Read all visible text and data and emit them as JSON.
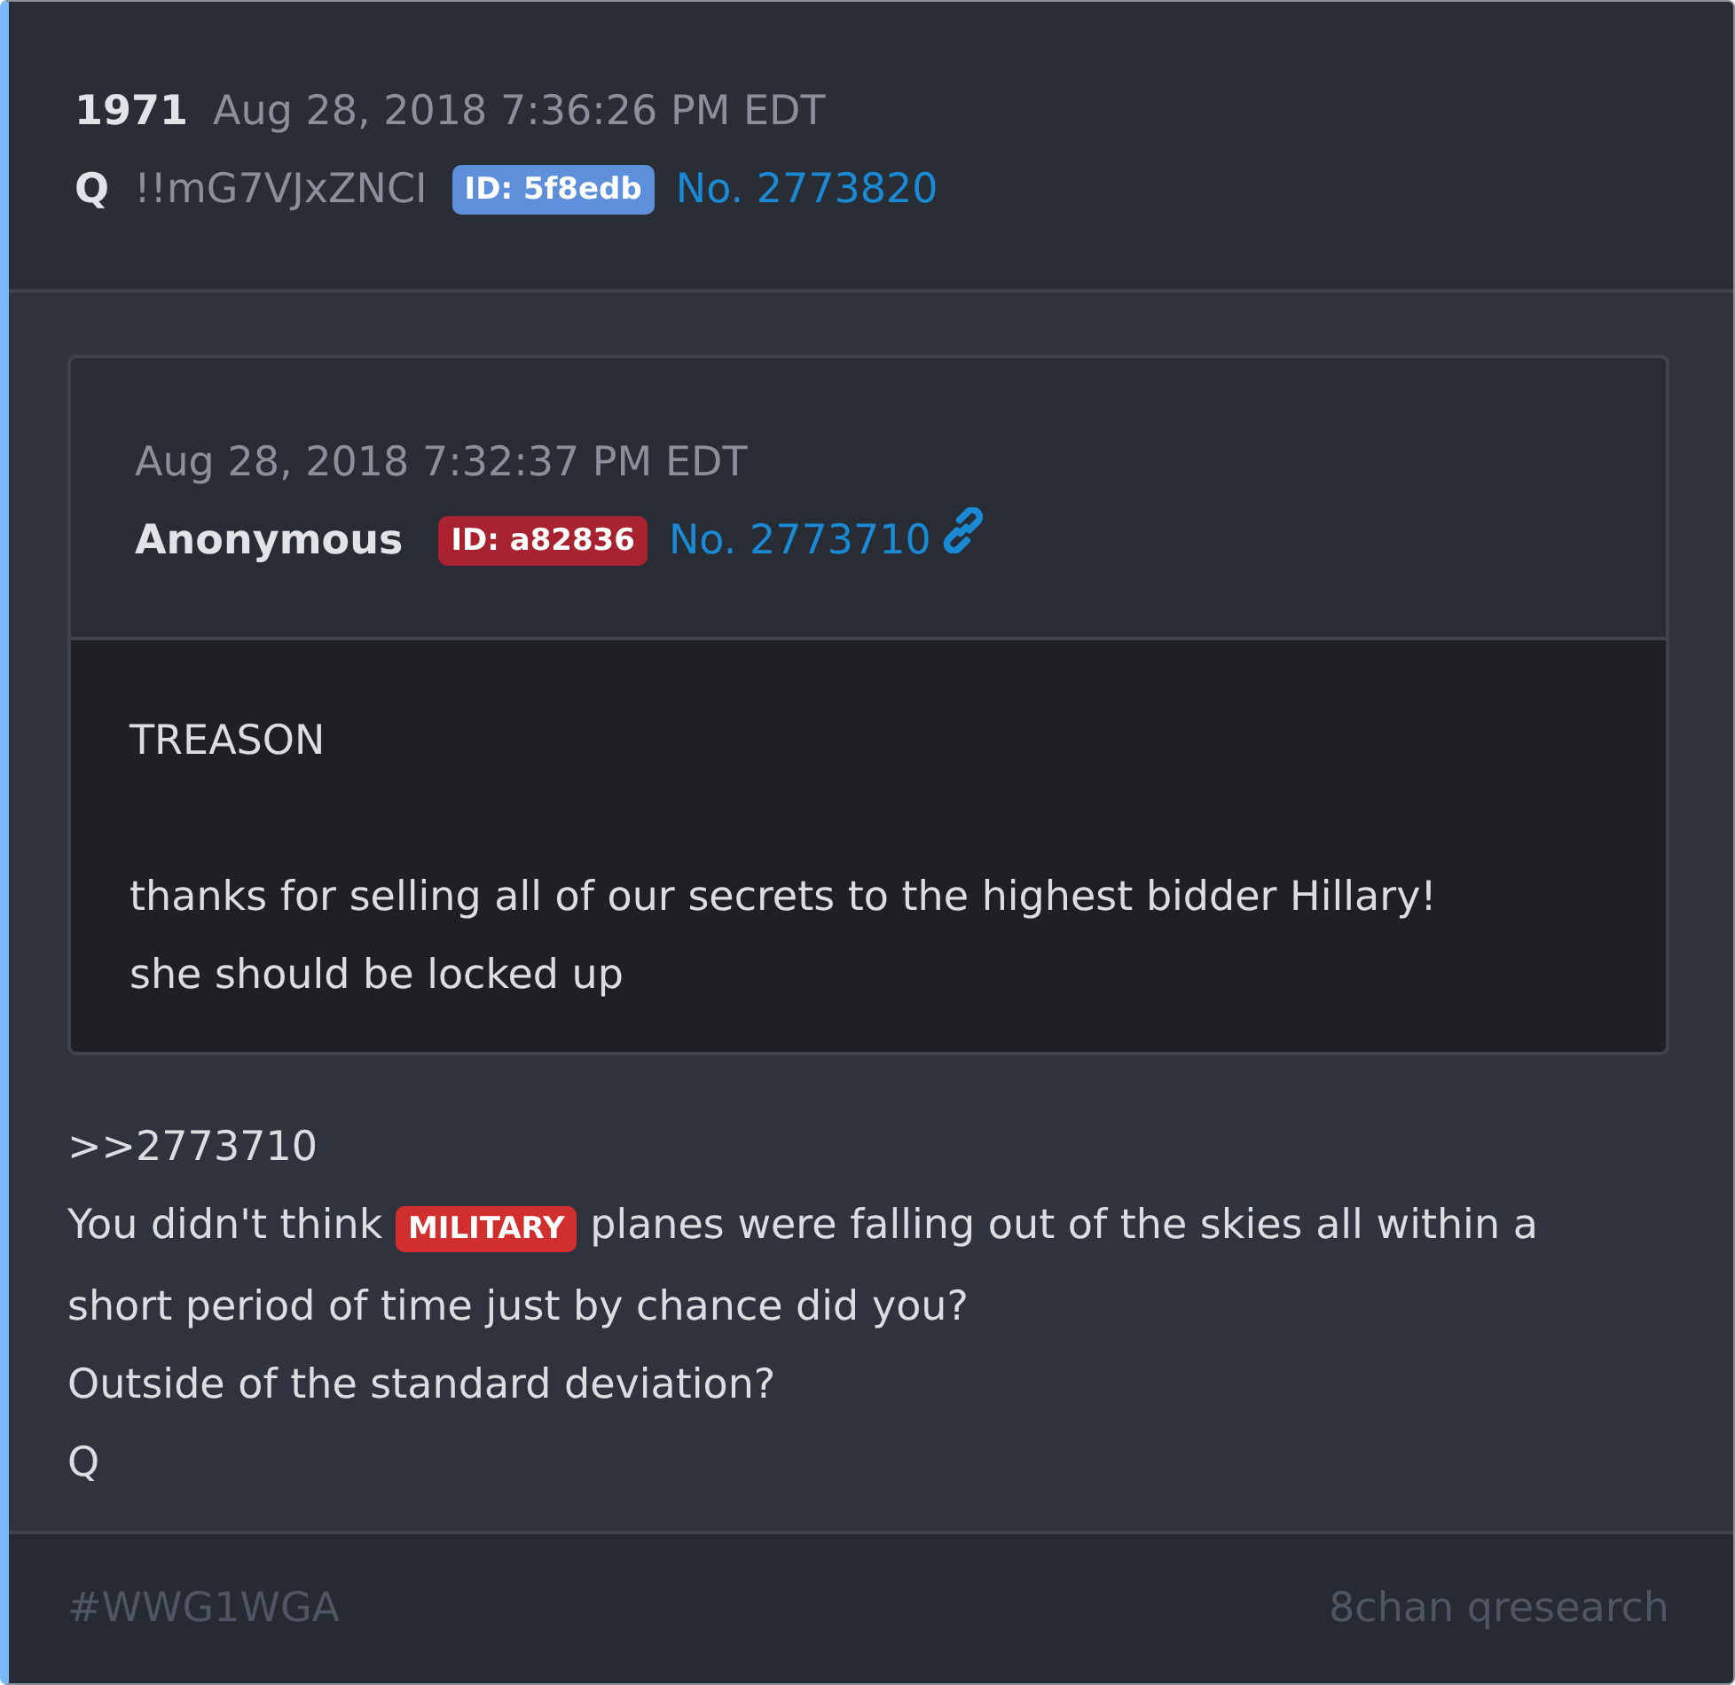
{
  "post": {
    "number": "1971",
    "timestamp": "Aug 28, 2018 7:36:26 PM EDT",
    "author": "Q",
    "tripcode": "!!mG7VJxZNCI",
    "id_badge": "ID: 5f8edb",
    "post_link": "No. 2773820"
  },
  "quoted_post": {
    "timestamp": "Aug 28, 2018 7:32:37 PM EDT",
    "author": "Anonymous",
    "id_badge": "ID: a82836",
    "post_link": "No. 2773710",
    "paragraphs": [
      [
        "TREASON"
      ],
      [
        "thanks for selling all of our secrets to the highest bidder Hillary!",
        "she should be locked up"
      ]
    ]
  },
  "body": {
    "lines": [
      [
        {
          "kind": "text",
          "text": ">>2773710"
        }
      ],
      [
        {
          "kind": "text",
          "text": "You didn't think"
        },
        {
          "kind": "badge",
          "text": "MILITARY"
        },
        {
          "kind": "text",
          "text": "planes were falling out of the skies all within a"
        }
      ],
      [
        {
          "kind": "text",
          "text": "short period of time just by chance did you?"
        }
      ],
      [
        {
          "kind": "text",
          "text": "Outside of the standard deviation?"
        }
      ],
      [
        {
          "kind": "text",
          "text": "Q"
        }
      ]
    ]
  },
  "footer": {
    "hashtag": "#WWG1WGA",
    "source": "8chan qresearch"
  }
}
